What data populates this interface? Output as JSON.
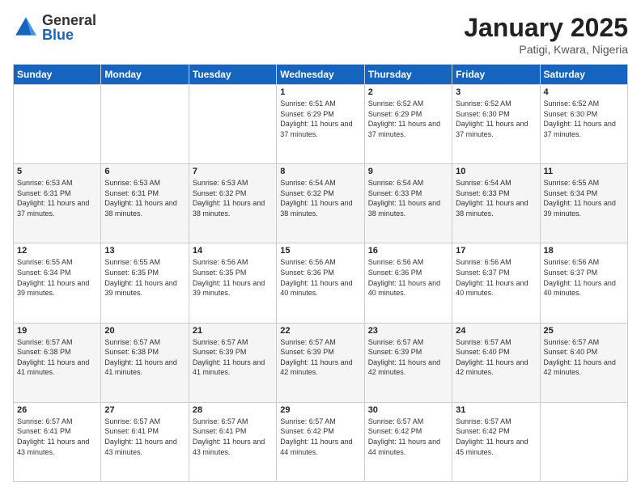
{
  "header": {
    "logo": {
      "general": "General",
      "blue": "Blue"
    },
    "title": "January 2025",
    "location": "Patigi, Kwara, Nigeria"
  },
  "weekdays": [
    "Sunday",
    "Monday",
    "Tuesday",
    "Wednesday",
    "Thursday",
    "Friday",
    "Saturday"
  ],
  "weeks": [
    [
      {
        "day": "",
        "sunrise": "",
        "sunset": "",
        "daylight": ""
      },
      {
        "day": "",
        "sunrise": "",
        "sunset": "",
        "daylight": ""
      },
      {
        "day": "",
        "sunrise": "",
        "sunset": "",
        "daylight": ""
      },
      {
        "day": "1",
        "sunrise": "Sunrise: 6:51 AM",
        "sunset": "Sunset: 6:29 PM",
        "daylight": "Daylight: 11 hours and 37 minutes."
      },
      {
        "day": "2",
        "sunrise": "Sunrise: 6:52 AM",
        "sunset": "Sunset: 6:29 PM",
        "daylight": "Daylight: 11 hours and 37 minutes."
      },
      {
        "day": "3",
        "sunrise": "Sunrise: 6:52 AM",
        "sunset": "Sunset: 6:30 PM",
        "daylight": "Daylight: 11 hours and 37 minutes."
      },
      {
        "day": "4",
        "sunrise": "Sunrise: 6:52 AM",
        "sunset": "Sunset: 6:30 PM",
        "daylight": "Daylight: 11 hours and 37 minutes."
      }
    ],
    [
      {
        "day": "5",
        "sunrise": "Sunrise: 6:53 AM",
        "sunset": "Sunset: 6:31 PM",
        "daylight": "Daylight: 11 hours and 37 minutes."
      },
      {
        "day": "6",
        "sunrise": "Sunrise: 6:53 AM",
        "sunset": "Sunset: 6:31 PM",
        "daylight": "Daylight: 11 hours and 38 minutes."
      },
      {
        "day": "7",
        "sunrise": "Sunrise: 6:53 AM",
        "sunset": "Sunset: 6:32 PM",
        "daylight": "Daylight: 11 hours and 38 minutes."
      },
      {
        "day": "8",
        "sunrise": "Sunrise: 6:54 AM",
        "sunset": "Sunset: 6:32 PM",
        "daylight": "Daylight: 11 hours and 38 minutes."
      },
      {
        "day": "9",
        "sunrise": "Sunrise: 6:54 AM",
        "sunset": "Sunset: 6:33 PM",
        "daylight": "Daylight: 11 hours and 38 minutes."
      },
      {
        "day": "10",
        "sunrise": "Sunrise: 6:54 AM",
        "sunset": "Sunset: 6:33 PM",
        "daylight": "Daylight: 11 hours and 38 minutes."
      },
      {
        "day": "11",
        "sunrise": "Sunrise: 6:55 AM",
        "sunset": "Sunset: 6:34 PM",
        "daylight": "Daylight: 11 hours and 39 minutes."
      }
    ],
    [
      {
        "day": "12",
        "sunrise": "Sunrise: 6:55 AM",
        "sunset": "Sunset: 6:34 PM",
        "daylight": "Daylight: 11 hours and 39 minutes."
      },
      {
        "day": "13",
        "sunrise": "Sunrise: 6:55 AM",
        "sunset": "Sunset: 6:35 PM",
        "daylight": "Daylight: 11 hours and 39 minutes."
      },
      {
        "day": "14",
        "sunrise": "Sunrise: 6:56 AM",
        "sunset": "Sunset: 6:35 PM",
        "daylight": "Daylight: 11 hours and 39 minutes."
      },
      {
        "day": "15",
        "sunrise": "Sunrise: 6:56 AM",
        "sunset": "Sunset: 6:36 PM",
        "daylight": "Daylight: 11 hours and 40 minutes."
      },
      {
        "day": "16",
        "sunrise": "Sunrise: 6:56 AM",
        "sunset": "Sunset: 6:36 PM",
        "daylight": "Daylight: 11 hours and 40 minutes."
      },
      {
        "day": "17",
        "sunrise": "Sunrise: 6:56 AM",
        "sunset": "Sunset: 6:37 PM",
        "daylight": "Daylight: 11 hours and 40 minutes."
      },
      {
        "day": "18",
        "sunrise": "Sunrise: 6:56 AM",
        "sunset": "Sunset: 6:37 PM",
        "daylight": "Daylight: 11 hours and 40 minutes."
      }
    ],
    [
      {
        "day": "19",
        "sunrise": "Sunrise: 6:57 AM",
        "sunset": "Sunset: 6:38 PM",
        "daylight": "Daylight: 11 hours and 41 minutes."
      },
      {
        "day": "20",
        "sunrise": "Sunrise: 6:57 AM",
        "sunset": "Sunset: 6:38 PM",
        "daylight": "Daylight: 11 hours and 41 minutes."
      },
      {
        "day": "21",
        "sunrise": "Sunrise: 6:57 AM",
        "sunset": "Sunset: 6:39 PM",
        "daylight": "Daylight: 11 hours and 41 minutes."
      },
      {
        "day": "22",
        "sunrise": "Sunrise: 6:57 AM",
        "sunset": "Sunset: 6:39 PM",
        "daylight": "Daylight: 11 hours and 42 minutes."
      },
      {
        "day": "23",
        "sunrise": "Sunrise: 6:57 AM",
        "sunset": "Sunset: 6:39 PM",
        "daylight": "Daylight: 11 hours and 42 minutes."
      },
      {
        "day": "24",
        "sunrise": "Sunrise: 6:57 AM",
        "sunset": "Sunset: 6:40 PM",
        "daylight": "Daylight: 11 hours and 42 minutes."
      },
      {
        "day": "25",
        "sunrise": "Sunrise: 6:57 AM",
        "sunset": "Sunset: 6:40 PM",
        "daylight": "Daylight: 11 hours and 42 minutes."
      }
    ],
    [
      {
        "day": "26",
        "sunrise": "Sunrise: 6:57 AM",
        "sunset": "Sunset: 6:41 PM",
        "daylight": "Daylight: 11 hours and 43 minutes."
      },
      {
        "day": "27",
        "sunrise": "Sunrise: 6:57 AM",
        "sunset": "Sunset: 6:41 PM",
        "daylight": "Daylight: 11 hours and 43 minutes."
      },
      {
        "day": "28",
        "sunrise": "Sunrise: 6:57 AM",
        "sunset": "Sunset: 6:41 PM",
        "daylight": "Daylight: 11 hours and 43 minutes."
      },
      {
        "day": "29",
        "sunrise": "Sunrise: 6:57 AM",
        "sunset": "Sunset: 6:42 PM",
        "daylight": "Daylight: 11 hours and 44 minutes."
      },
      {
        "day": "30",
        "sunrise": "Sunrise: 6:57 AM",
        "sunset": "Sunset: 6:42 PM",
        "daylight": "Daylight: 11 hours and 44 minutes."
      },
      {
        "day": "31",
        "sunrise": "Sunrise: 6:57 AM",
        "sunset": "Sunset: 6:42 PM",
        "daylight": "Daylight: 11 hours and 45 minutes."
      },
      {
        "day": "",
        "sunrise": "",
        "sunset": "",
        "daylight": ""
      }
    ]
  ]
}
